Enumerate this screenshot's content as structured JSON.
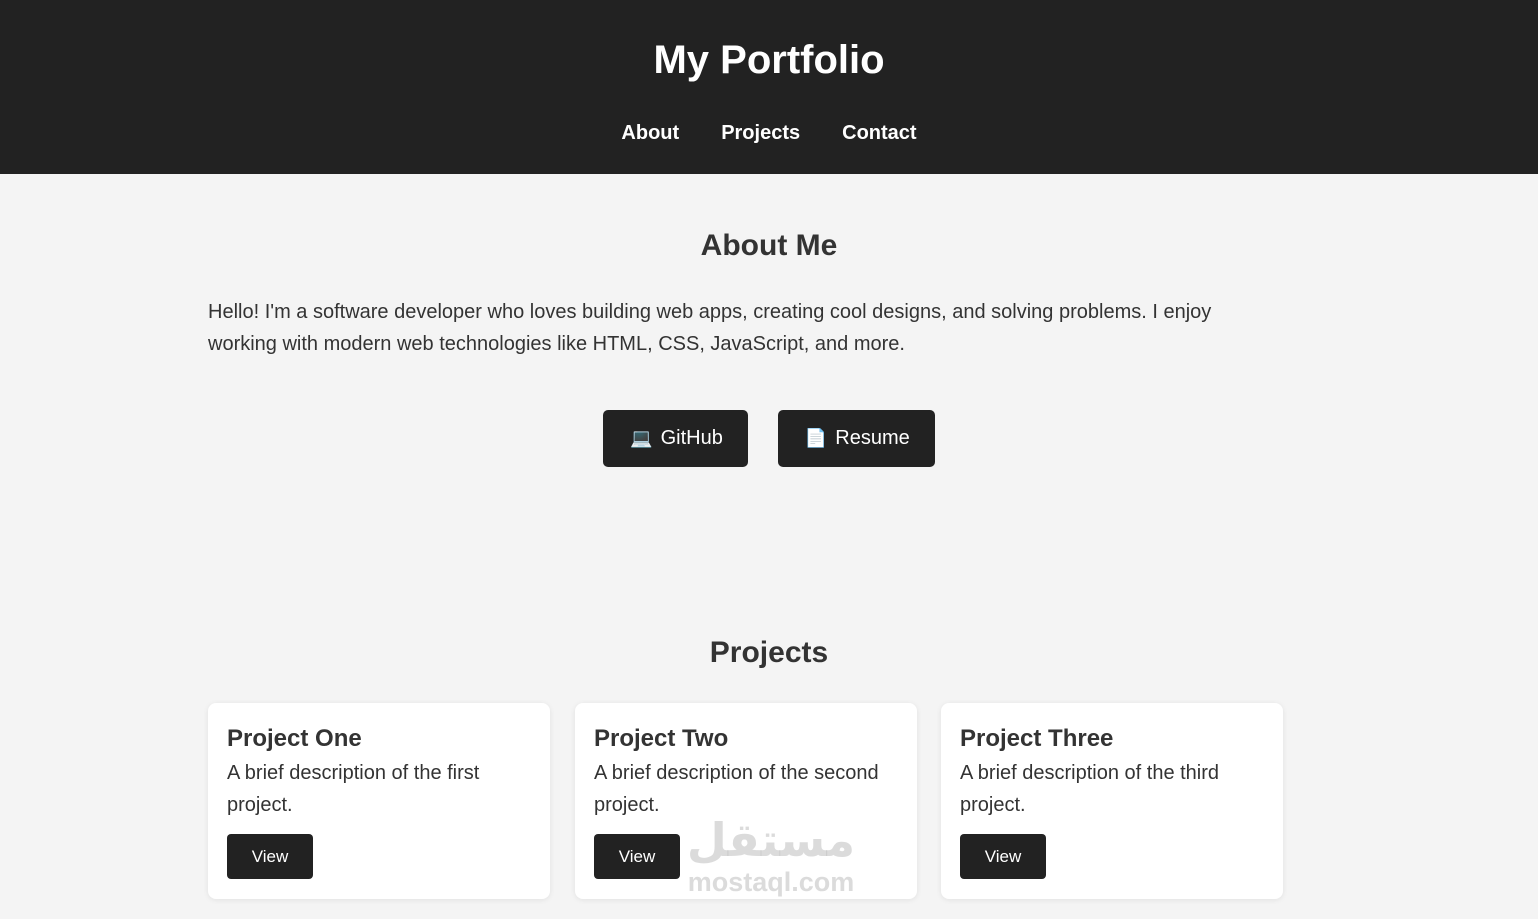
{
  "header": {
    "site_title": "My Portfolio",
    "nav": [
      {
        "label": "About"
      },
      {
        "label": "Projects"
      },
      {
        "label": "Contact"
      }
    ]
  },
  "about": {
    "title": "About Me",
    "text": "Hello! I'm a software developer who loves building web apps, creating cool designs, and solving problems. I enjoy working with modern web technologies like HTML, CSS, JavaScript, and more.",
    "buttons": [
      {
        "icon": "laptop-icon",
        "glyph": "💻",
        "label": "GitHub"
      },
      {
        "icon": "document-icon",
        "glyph": "📄",
        "label": "Resume"
      }
    ]
  },
  "projects": {
    "title": "Projects",
    "cards": [
      {
        "title": "Project One",
        "description": "A brief description of the first project.",
        "button": "View"
      },
      {
        "title": "Project Two",
        "description": "A brief description of the second project.",
        "button": "View"
      },
      {
        "title": "Project Three",
        "description": "A brief description of the third project.",
        "button": "View"
      }
    ]
  },
  "watermark": {
    "arabic": "مستقل",
    "latin": "mostaql.com"
  },
  "colors": {
    "header_bg": "#222222",
    "page_bg": "#f4f4f4",
    "card_bg": "#ffffff",
    "button_bg": "#222222",
    "text": "#333333"
  }
}
